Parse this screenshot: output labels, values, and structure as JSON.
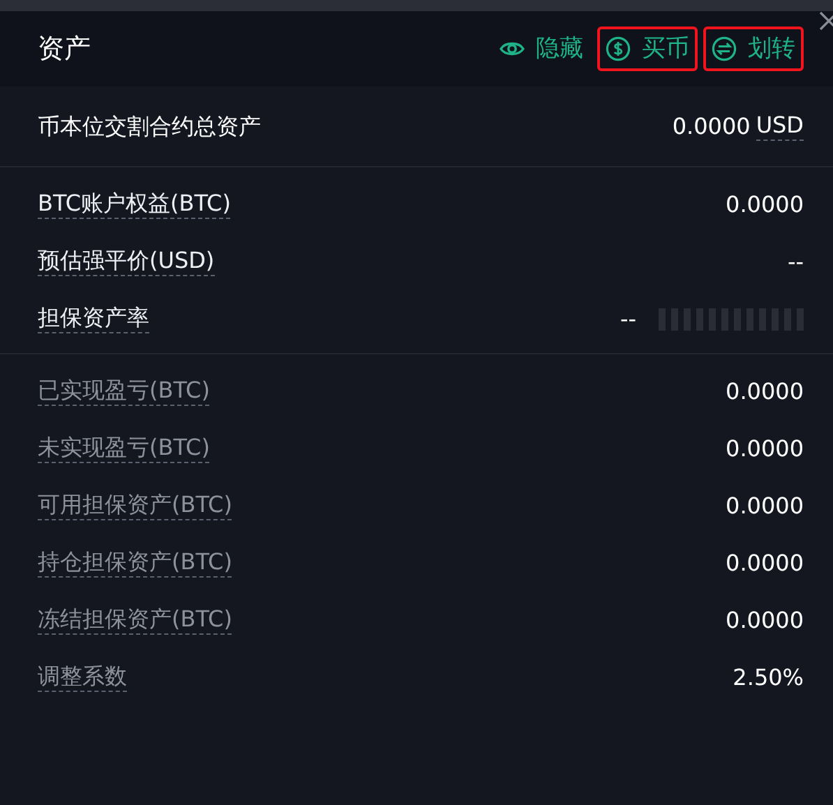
{
  "header": {
    "title": "资产",
    "actions": [
      {
        "kind": "eye",
        "label": "隐藏",
        "highlighted": false
      },
      {
        "kind": "coin",
        "label": "买币",
        "highlighted": true
      },
      {
        "kind": "transfer",
        "label": "划转",
        "highlighted": true
      }
    ]
  },
  "total": {
    "label": "币本位交割合约总资产",
    "value": "0.0000",
    "unit": "USD"
  },
  "account_rows": [
    {
      "label": "BTC账户权益(BTC)",
      "value": "0.0000"
    },
    {
      "label": "预估强平价(USD)",
      "value": "--"
    },
    {
      "label": "担保资产率",
      "value": "--",
      "kind": "meter"
    }
  ],
  "detail_rows": [
    {
      "label": "已实现盈亏(BTC)",
      "value": "0.0000",
      "muted": true
    },
    {
      "label": "未实现盈亏(BTC)",
      "value": "0.0000",
      "muted": true
    },
    {
      "label": "可用担保资产(BTC)",
      "value": "0.0000",
      "muted": true
    },
    {
      "label": "持仓担保资产(BTC)",
      "value": "0.0000",
      "muted": true
    },
    {
      "label": "冻结担保资产(BTC)",
      "value": "0.0000",
      "muted": true
    },
    {
      "label": "调整系数",
      "value": "2.50%",
      "muted": true
    }
  ]
}
